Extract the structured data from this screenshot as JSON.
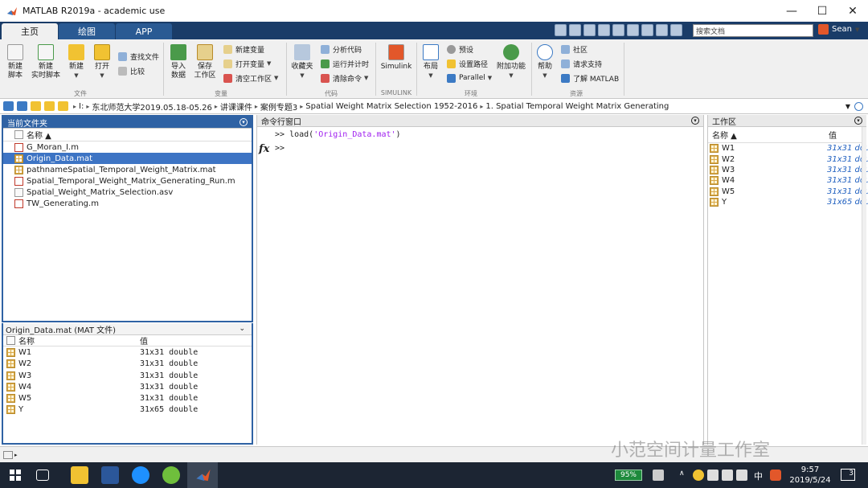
{
  "window": {
    "title": "MATLAB R2019a - academic use",
    "minimize": "—",
    "maximize": "☐",
    "close": "✕"
  },
  "tabs": [
    "主页",
    "绘图",
    "APP"
  ],
  "search": {
    "placeholder": "搜索文档"
  },
  "user": {
    "name": "Sean"
  },
  "ribbon": {
    "file": {
      "label": "文件",
      "new_script": "新建\n脚本",
      "new_live": "新建\n实时脚本",
      "new": "新建",
      "open": "打开",
      "find_files": "查找文件",
      "compare": "比较"
    },
    "variable": {
      "label": "变量",
      "import": "导入\n数据",
      "save_ws": "保存\n工作区",
      "new_var": "新建变量",
      "open_var": "打开变量",
      "clear_ws": "清空工作区"
    },
    "code": {
      "label": "代码",
      "favorites": "收藏夹",
      "analyze": "分析代码",
      "run_time": "运行并计时",
      "clear_cmd": "清除命令"
    },
    "simulink": {
      "label": "SIMULINK",
      "simulink": "Simulink"
    },
    "env": {
      "label": "环境",
      "layout": "布局",
      "prefs": "预设",
      "set_path": "设置路径",
      "parallel": "Parallel",
      "addons": "附加功能"
    },
    "resources": {
      "label": "资源",
      "help": "帮助",
      "community": "社区",
      "support": "请求支持",
      "learn": "了解 MATLAB"
    }
  },
  "address": {
    "crumbs": [
      "I:",
      "东北师范大学2019.05.18-05.26",
      "讲课课件",
      "案例专题3",
      "Spatial Weight Matrix Selection 1952-2016",
      "1. Spatial Temporal Weight Matrix Generating"
    ]
  },
  "current_folder": {
    "title": "当前文件夹",
    "col_name": "名称 ▲",
    "files": [
      {
        "name": "G_Moran_I.m",
        "type": "m",
        "selected": false
      },
      {
        "name": "Origin_Data.mat",
        "type": "mat",
        "selected": true
      },
      {
        "name": "pathnameSpatial_Temporal_Weight_Matrix.mat",
        "type": "mat",
        "selected": false
      },
      {
        "name": "Spatial_Temporal_Weight_Matrix_Generating_Run.m",
        "type": "m",
        "selected": false
      },
      {
        "name": "Spatial_Weight_Matrix_Selection.asv",
        "type": "asv",
        "selected": false
      },
      {
        "name": "TW_Generating.m",
        "type": "m",
        "selected": false
      }
    ]
  },
  "details": {
    "title": "Origin_Data.mat  (MAT 文件)",
    "col_name": "名称",
    "col_value": "值",
    "vars": [
      {
        "name": "W1",
        "value": "31x31 double"
      },
      {
        "name": "W2",
        "value": "31x31 double"
      },
      {
        "name": "W3",
        "value": "31x31 double"
      },
      {
        "name": "W4",
        "value": "31x31 double"
      },
      {
        "name": "W5",
        "value": "31x31 double"
      },
      {
        "name": "Y",
        "value": "31x65 double"
      }
    ]
  },
  "command_window": {
    "title": "命令行窗口",
    "prompt": ">>",
    "line1_cmd": "load(",
    "line1_str": "'Origin_Data.mat'",
    "line1_end": ")",
    "fx": "fx"
  },
  "workspace": {
    "title": "工作区",
    "col_name": "名称 ▲",
    "col_value": "值",
    "vars": [
      {
        "name": "W1",
        "value": "31x31 dou"
      },
      {
        "name": "W2",
        "value": "31x31 dou"
      },
      {
        "name": "W3",
        "value": "31x31 dou"
      },
      {
        "name": "W4",
        "value": "31x31 dou"
      },
      {
        "name": "W5",
        "value": "31x31 dou"
      },
      {
        "name": "Y",
        "value": "31x65 dou"
      }
    ]
  },
  "watermark": "小范空间计量工作室",
  "taskbar": {
    "battery": "95%",
    "ime": "中",
    "time": "9:57",
    "date": "2019/5/24",
    "notif_count": "3"
  }
}
